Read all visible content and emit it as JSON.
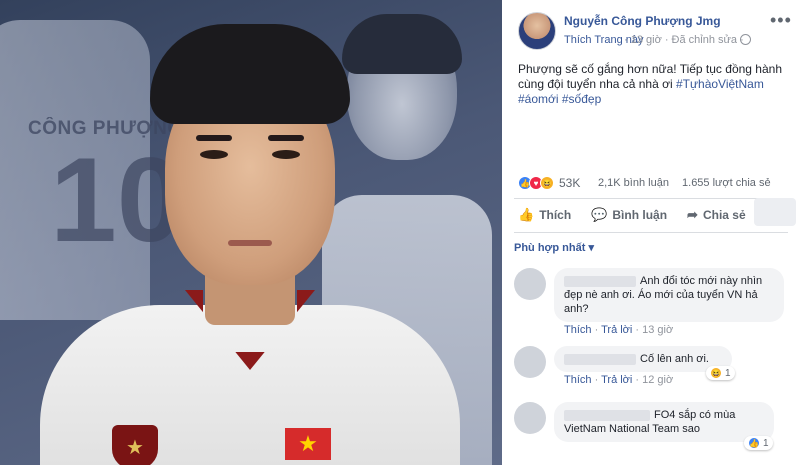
{
  "photo": {
    "jersey_name": "CÔNG PHƯỢNG",
    "jersey_number": "10"
  },
  "post": {
    "page_name": "Nguyễn Công Phượng Jmg",
    "like_page": "Thích Trang này",
    "time": "· 13 giờ · Đã chỉnh sửa ·",
    "text_main": "Phượng sẽ cố gắng hơn nữa! Tiếp tục đồng hành cùng đội tuyển nha cả nhà ơi",
    "hashtags": "#TựhàoViệtNam #áomới #sốđẹp"
  },
  "stats": {
    "reactions": "53K",
    "comments": "2,1K bình luận",
    "shares": "1.655 lượt chia sẻ"
  },
  "actions": {
    "like": "Thích",
    "comment": "Bình luận",
    "share": "Chia sẻ"
  },
  "sort_label": "Phù hợp nhất",
  "comments": [
    {
      "text": "Anh đổi tóc mới này nhìn đẹp nè anh ơi. Áo mới của tuyển VN hả anh?",
      "like": "Thích",
      "reply": "Trả lời",
      "time": "13 giờ"
    },
    {
      "text": "Cố lên anh ơi.",
      "like": "Thích",
      "reply": "Trả lời",
      "time": "12 giờ",
      "reaction_count": "1"
    },
    {
      "text": "FO4 sắp có mùa VietNam National Team sao",
      "reaction_count": "1"
    }
  ]
}
